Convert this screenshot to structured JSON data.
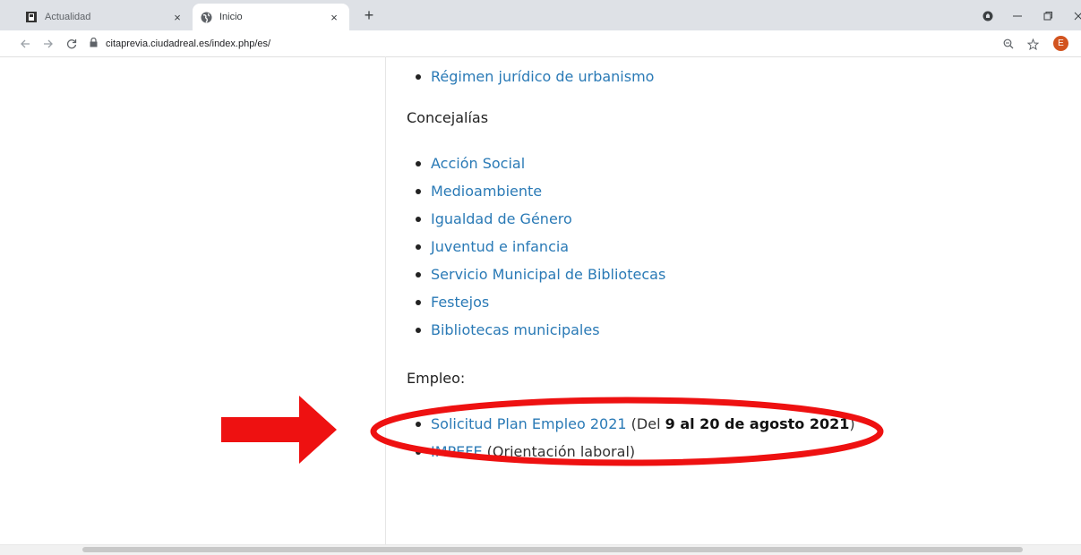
{
  "browser": {
    "tabs": [
      {
        "title": "Actualidad",
        "active": false
      },
      {
        "title": "Inicio",
        "active": true
      }
    ],
    "close_glyph": "×",
    "new_tab_glyph": "+",
    "url": "citaprevia.ciudadreal.es/index.php/es/",
    "profile_initial": "E",
    "accent_color": "#d2541f"
  },
  "content": {
    "top_items": [
      "Régimen jurídico de urbanismo"
    ],
    "concejalias_heading": "Concejalías",
    "concejalias_items": [
      "Acción Social",
      "Medioambiente",
      "Igualdad de Género",
      "Juventud e infancia",
      "Servicio Municipal de Bibliotecas",
      "Festejos",
      "Bibliotecas municipales"
    ],
    "empleo_heading": "Empleo:",
    "empleo_items": [
      {
        "link": "Solicitud Plan Empleo 2021",
        "pre": " (Del ",
        "bold": "9 al 20 de agosto 2021",
        "post": ")"
      },
      {
        "link": "IMPEFE",
        "pre": " (Orientación laboral)",
        "bold": "",
        "post": ""
      }
    ]
  },
  "annotation": {
    "color": "#ee1111"
  }
}
